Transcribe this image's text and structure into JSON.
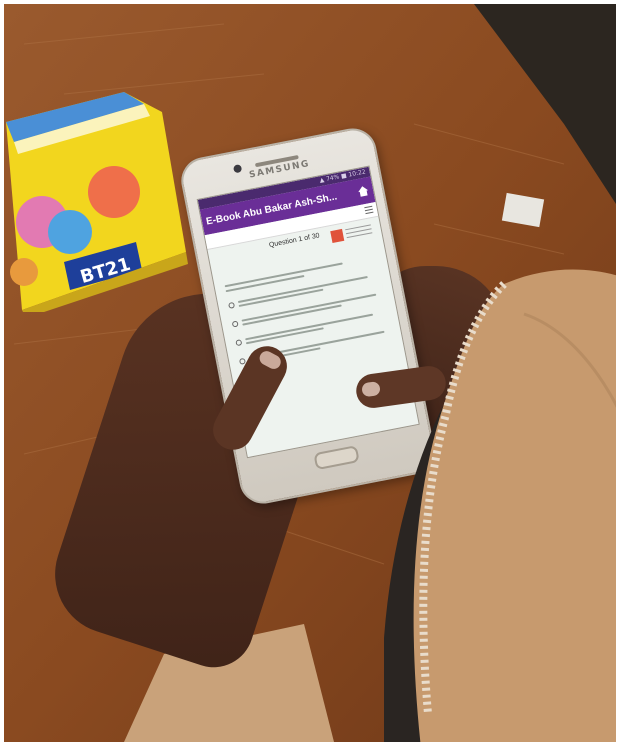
{
  "photo": {
    "colors": {
      "table": "#8a4b22",
      "pouch": "#f2d61e",
      "app_bar": "#6a2e97",
      "hijab": "#c79a6e",
      "skin": "#4a2a1c"
    }
  },
  "pouch": {
    "brand_text": "BT21"
  },
  "phone": {
    "brand": "SAMSUNG",
    "screen": {
      "status_text": "▲ 74% ■ 10:22",
      "app_title": "E-Book Abu Bakar Ash-Sh...",
      "question_label": "Question 1 of 30",
      "icons": [
        "home-icon",
        "menu-icon"
      ]
    }
  }
}
